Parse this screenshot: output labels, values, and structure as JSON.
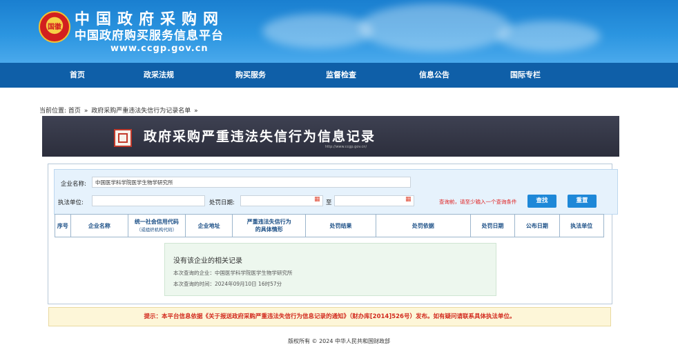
{
  "header": {
    "emblem_text": "国徽",
    "title_line1": "中国政府采购网",
    "title_line2": "中国政府购买服务信息平台",
    "url": "www.ccgp.gov.cn"
  },
  "nav": {
    "items": [
      {
        "label": "首页"
      },
      {
        "label": "政采法规"
      },
      {
        "label": "购买服务"
      },
      {
        "label": "监督检查"
      },
      {
        "label": "信息公告"
      },
      {
        "label": "国际专栏"
      }
    ]
  },
  "breadcrumb": {
    "prefix": "当前位置:",
    "home": "首页",
    "separator": "»",
    "current": "政府采购严重违法失信行为记录名单",
    "trailing": "»"
  },
  "banner": {
    "title": "政府采购严重违法失信行为信息记录",
    "subtitle": "http://www.ccgp.gov.cn/"
  },
  "filters": {
    "company_label": "企业名称:",
    "company_value": "中国医学科学院医学生物学研究所",
    "agency_label": "执法单位:",
    "agency_value": "",
    "date_label": "处罚日期:",
    "date_from": "",
    "date_to_label": "至",
    "date_to": "",
    "calendar_icon": "calendar-icon",
    "tip": "查询前，请至少输入一个查询条件",
    "search_label": "查找",
    "reset_label": "重置"
  },
  "table": {
    "columns": [
      [
        "序号"
      ],
      [
        "企业名称"
      ],
      [
        "统一社会信用代码",
        "（或组织机构代码）"
      ],
      [
        "企业地址"
      ],
      [
        "严重违法失信行为",
        "的具体情形"
      ],
      [
        "处罚结果"
      ],
      [
        "处罚依据"
      ],
      [
        "处罚日期"
      ],
      [
        "公布日期"
      ],
      [
        "执法单位"
      ]
    ]
  },
  "empty_state": {
    "title": "没有该企业的相关记录",
    "query_company": "本次查询的企业：中国医学科学院医学生物学研究所",
    "query_time": "本次查询的时间：2024年09月10日 16时57分"
  },
  "notice": "提示：本平台信息依据《关于报送政府采购严重违法失信行为信息记录的通知》（财办库[2014]526号）发布。如有疑问请联系具体执法单位。",
  "footer": "版权所有 © 2024 中华人民共和国财政部",
  "colors": {
    "header_blue": "#1a7fd0",
    "nav_blue": "#0f5fa8",
    "banner_dark": "#3e4152",
    "button_blue": "#1e88d8",
    "tip_red": "#e02020",
    "notice_bg": "#fdf6d8"
  }
}
